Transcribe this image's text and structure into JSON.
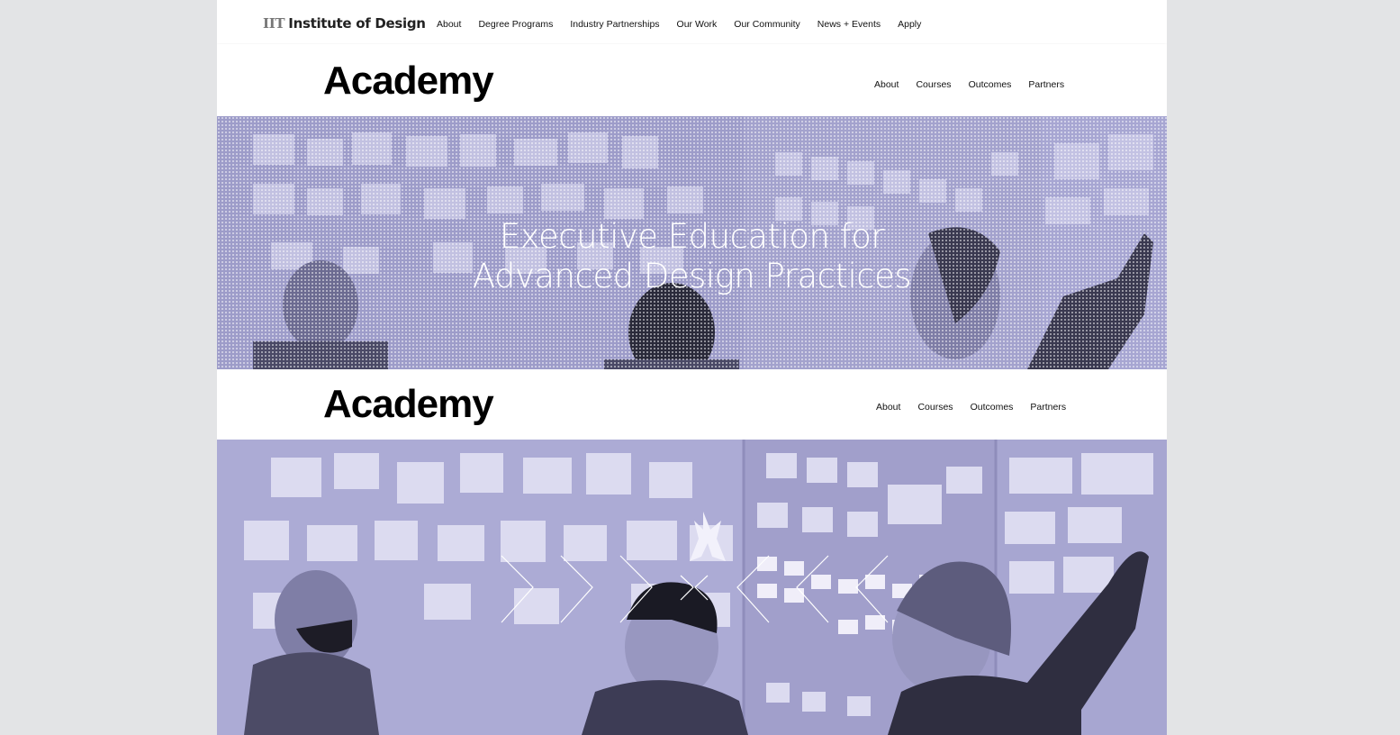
{
  "global_nav": {
    "logo_prefix": "IIT",
    "logo_text": "Institute of Design",
    "links": [
      "About",
      "Degree Programs",
      "Industry Partnerships",
      "Our Work",
      "Our Community",
      "News + Events",
      "Apply"
    ]
  },
  "academy_nav": {
    "title": "Academy",
    "links": [
      "About",
      "Courses",
      "Outcomes",
      "Partners"
    ]
  },
  "hero": {
    "heading_line1": "Executive Education for",
    "heading_line2": "Advanced Design Practices"
  },
  "colors": {
    "overlay": "#a9a8d3",
    "background": "#e3e4e6"
  },
  "icons": [
    "chevron-right-icon",
    "chevron-left-icon"
  ]
}
